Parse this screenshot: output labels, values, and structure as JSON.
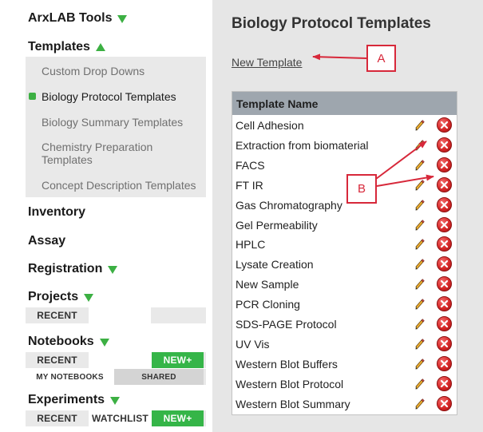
{
  "sidebar": {
    "brand": "ArxLAB Tools",
    "templates_label": "Templates",
    "template_items": [
      {
        "label": "Custom Drop Downs"
      },
      {
        "label": "Biology Protocol Templates"
      },
      {
        "label": "Biology Summary Templates"
      },
      {
        "label": "Chemistry Preparation Templates"
      },
      {
        "label": "Concept Description Templates"
      }
    ],
    "active_template_index": 1,
    "inventory": "Inventory",
    "assay": "Assay",
    "registration": "Registration",
    "projects": {
      "label": "Projects",
      "recent": "RECENT"
    },
    "notebooks": {
      "label": "Notebooks",
      "recent": "RECENT",
      "new": "NEW+",
      "my_notebooks": "MY NOTEBOOKS",
      "shared": "SHARED"
    },
    "experiments": {
      "label": "Experiments",
      "recent": "RECENT",
      "watchlist": "WATCHLIST",
      "new": "NEW+"
    }
  },
  "main": {
    "title": "Biology Protocol Templates",
    "new_template_link": "New Template",
    "table_header": "Template Name",
    "rows": [
      "Cell Adhesion",
      "Extraction from biomaterial",
      "FACS",
      "FT IR",
      "Gas Chromatography",
      "Gel Permeability",
      "HPLC",
      "Lysate Creation",
      "New Sample",
      "PCR Cloning",
      "SDS-PAGE Protocol",
      "UV Vis",
      "Western Blot Buffers",
      "Western Blot Protocol",
      "Western Blot Summary"
    ]
  },
  "annotations": {
    "a": "A",
    "b": "B"
  },
  "colors": {
    "accent_green": "#3cb043",
    "annotation_red": "#d7283a",
    "header_gray": "#9ea6ae",
    "delete_red": "#d62828"
  },
  "icons": {
    "edit": "pencil-icon",
    "delete": "delete-x-icon",
    "collapse": "triangle-down-icon",
    "expand": "triangle-up-icon"
  }
}
